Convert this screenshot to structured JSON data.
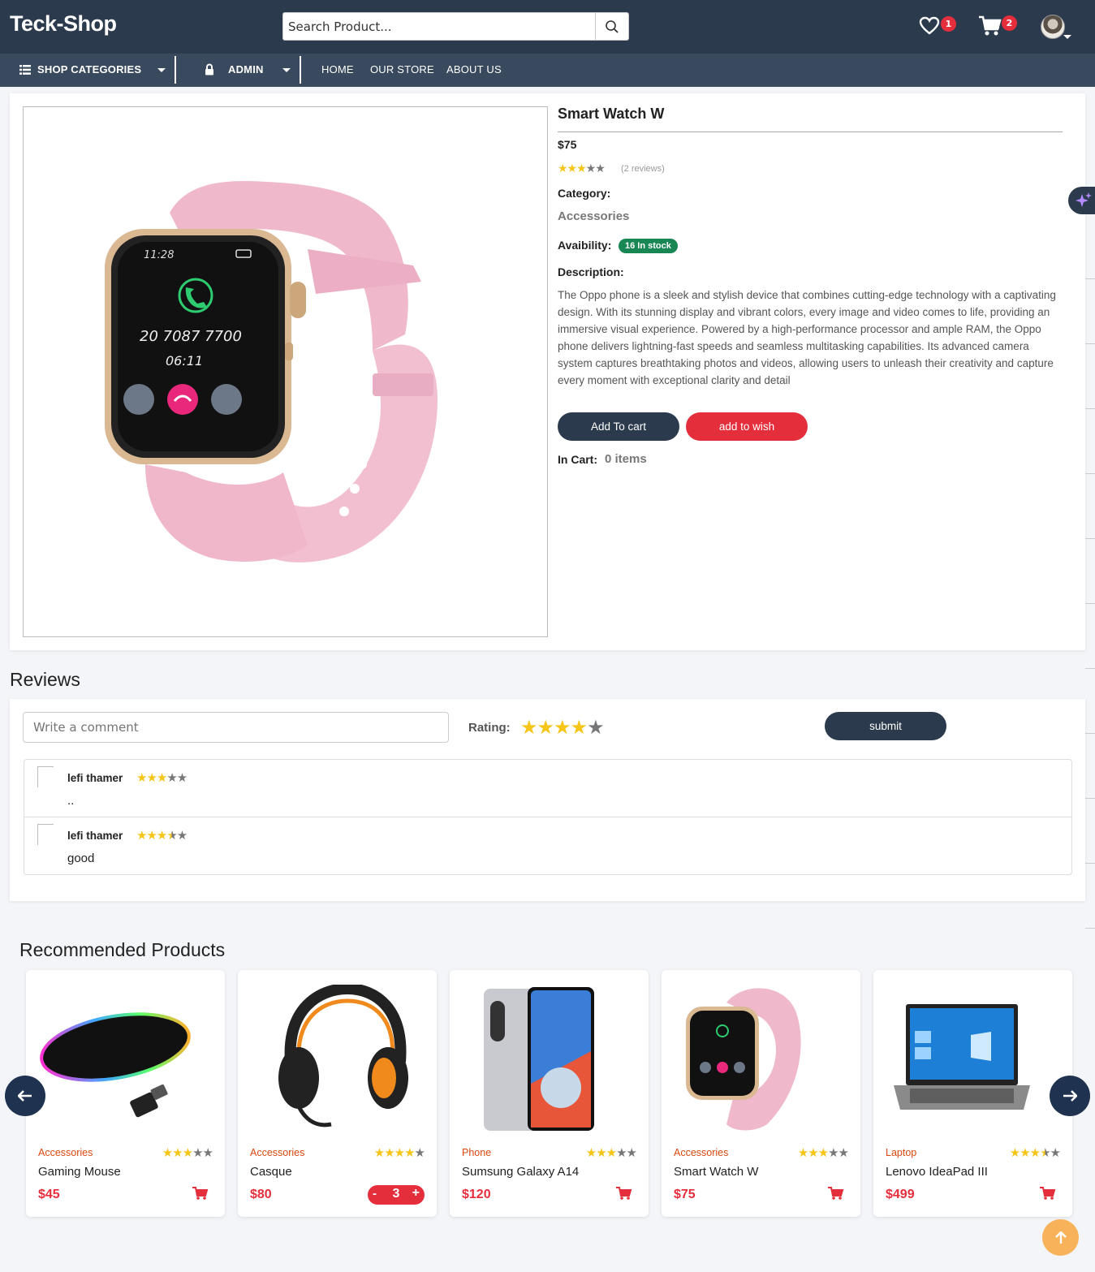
{
  "header": {
    "logo": "Teck-Shop",
    "search_placeholder": "Search Product...",
    "wishlist_count": "1",
    "cart_count": "2"
  },
  "menu": {
    "categories": "SHOP CATEGORIES",
    "admin": "ADMIN",
    "home": "HOME",
    "store": "OUR STORE",
    "about": "ABOUT US"
  },
  "product": {
    "title": "Smart Watch W",
    "price": "$75",
    "rating": 3,
    "reviews_text": "(2 reviews)",
    "category_label": "Category:",
    "category": "Accessories",
    "availability_label": "Avaibility:",
    "stock": "16 In stock",
    "description_label": "Description:",
    "description": "The Oppo phone is a sleek and stylish device that combines cutting-edge technology with a captivating design. With its stunning display and vibrant colors, every image and video comes to life, providing an immersive visual experience. Powered by a high-performance processor and ample RAM, the Oppo phone delivers lightning-fast speeds and seamless multitasking capabilities. Its advanced camera system captures breathtaking photos and videos, allowing users to unleash their creativity and capture every moment with exceptional clarity and detail",
    "add_to_cart": "Add To cart",
    "add_to_wish": "add to wish",
    "in_cart_label": "In Cart:",
    "in_cart_value": "0 items",
    "watch_time": "11:28",
    "watch_number": "20 7087 7700",
    "watch_timer": "06:11"
  },
  "reviews": {
    "heading": "Reviews",
    "comment_placeholder": "Write a comment",
    "rating_label": "Rating:",
    "rating_value": 4,
    "submit": "submit",
    "items": [
      {
        "author": "lefi thamer",
        "rating": 3,
        "text": ".."
      },
      {
        "author": "lefi thamer",
        "rating": 3.5,
        "text": "good"
      }
    ]
  },
  "recommended": {
    "heading": "Recommended Products",
    "items": [
      {
        "category": "Accessories",
        "name": "Gaming Mouse",
        "price": "$45",
        "rating": 3
      },
      {
        "category": "Accessories",
        "name": "Casque",
        "price": "$80",
        "rating": 4,
        "qty": "3"
      },
      {
        "category": "Phone",
        "name": "Sumsung Galaxy A14",
        "price": "$120",
        "rating": 3
      },
      {
        "category": "Accessories",
        "name": "Smart Watch W",
        "price": "$75",
        "rating": 3
      },
      {
        "category": "Laptop",
        "name": "Lenovo IdeaPad III",
        "price": "$499",
        "rating": 3.5
      }
    ]
  },
  "colors": {
    "header_bg": "#2b3a4d",
    "menu_bg": "#39495e",
    "accent_red": "#e52e3b",
    "stock_green": "#198754",
    "star_yellow": "#f5c518"
  }
}
